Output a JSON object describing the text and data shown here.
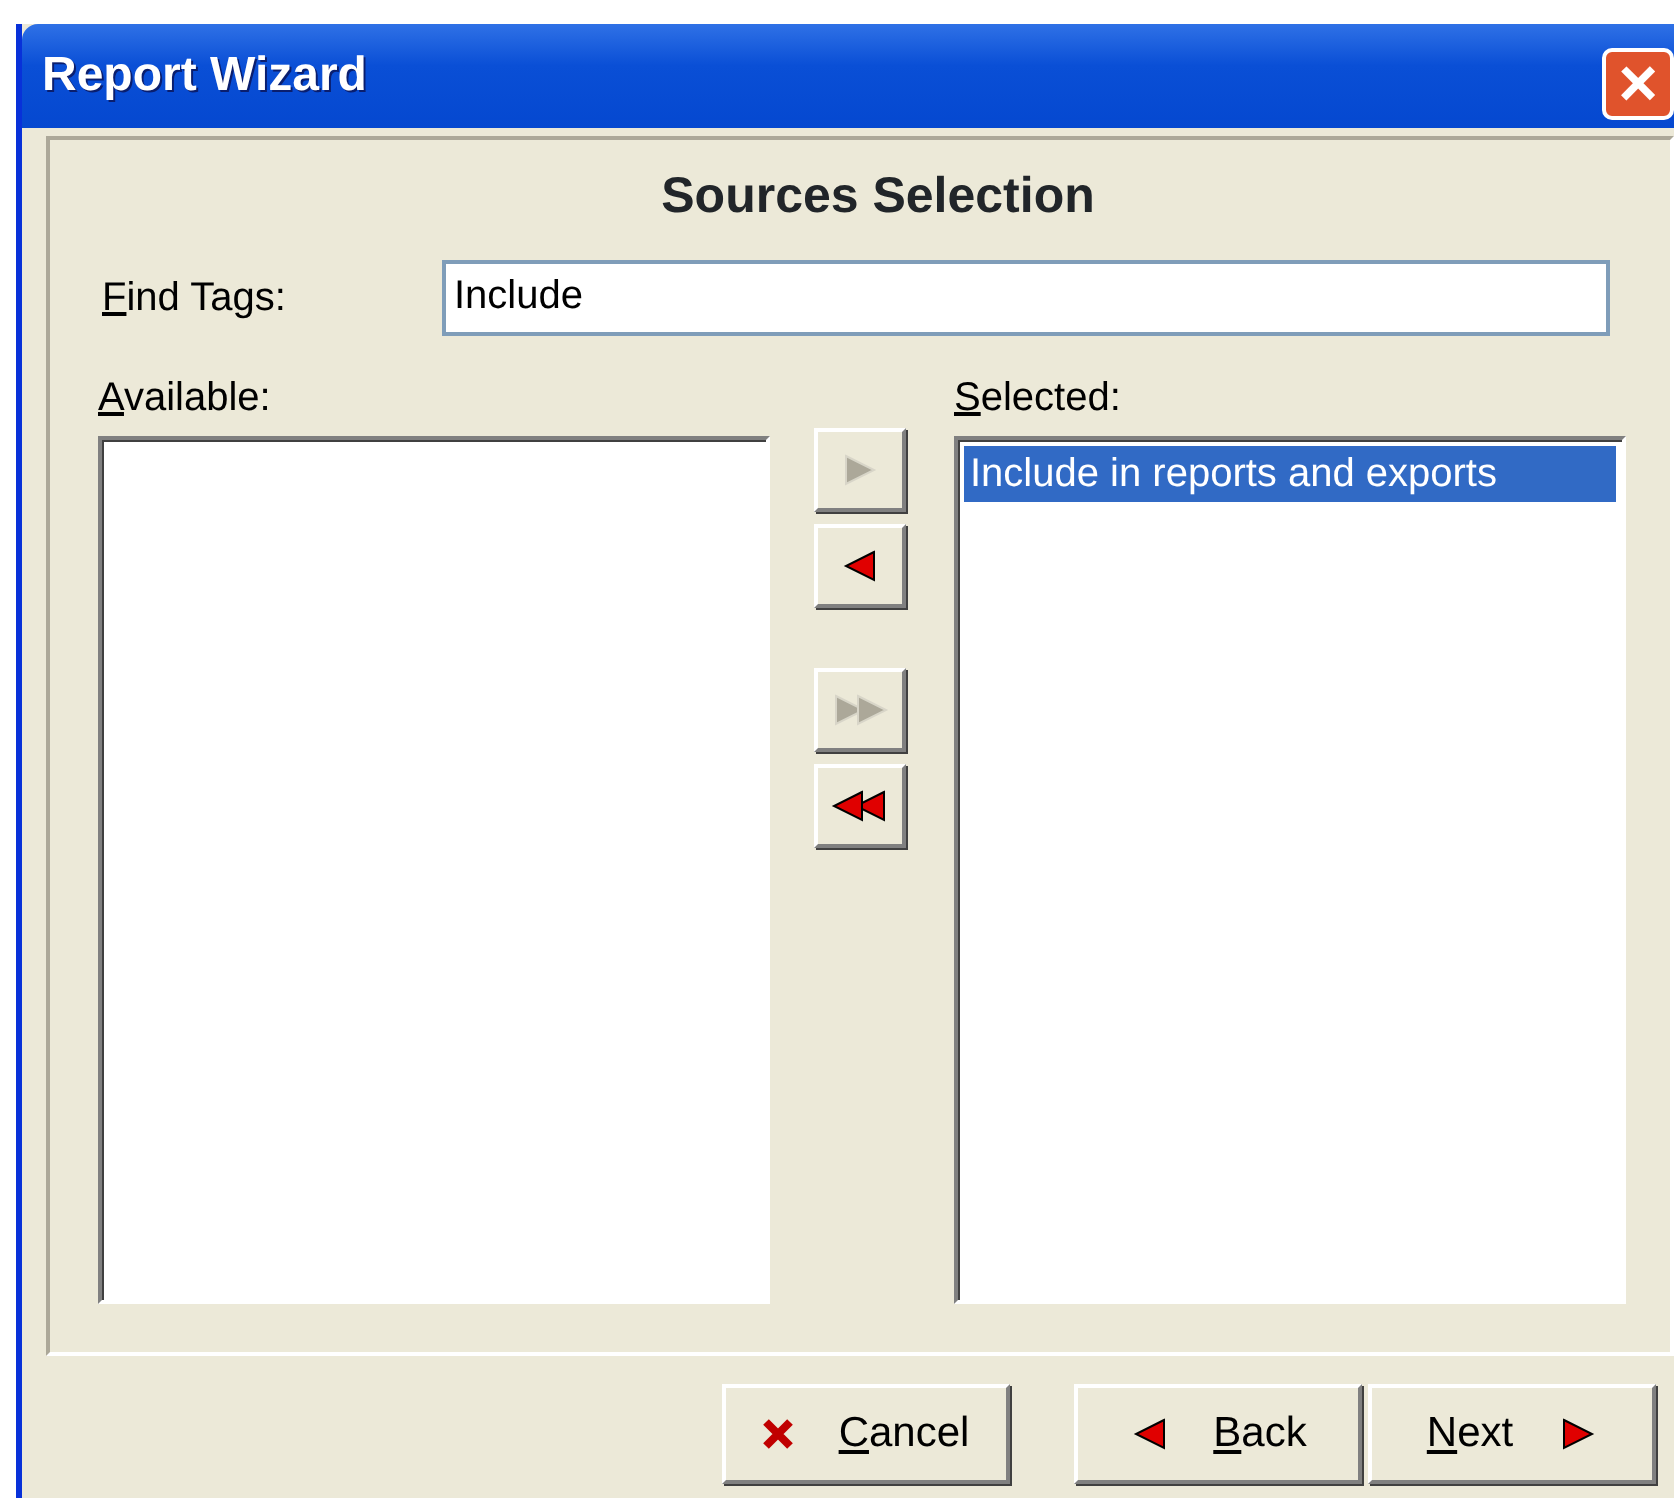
{
  "window": {
    "title": "Report Wizard",
    "close": "×"
  },
  "heading": "Sources Selection",
  "find_tags": {
    "label": "Find Tags:",
    "mnemonic_underlined": true,
    "value": "Include"
  },
  "available": {
    "label": "Available:",
    "mnemonic_underlined": true
  },
  "selected": {
    "label": "Selected:",
    "mnemonic_underlined": true,
    "items": [
      {
        "text": "Include in reports and exports",
        "selected": true
      }
    ]
  },
  "transfer_buttons": [
    {
      "kind": "add",
      "disabled": true
    },
    {
      "kind": "remove",
      "disabled": false
    },
    {
      "kind": "add_all",
      "disabled": true
    },
    {
      "kind": "remove_all",
      "disabled": false
    }
  ],
  "buttons": [
    {
      "kind": "cancel",
      "label": "Cancel",
      "mnemonic_underlined": true
    },
    {
      "kind": "back",
      "label": "Back",
      "mnemonic_underlined": true
    },
    {
      "kind": "next",
      "label": "Next",
      "mnemonic_underlined": true
    }
  ]
}
